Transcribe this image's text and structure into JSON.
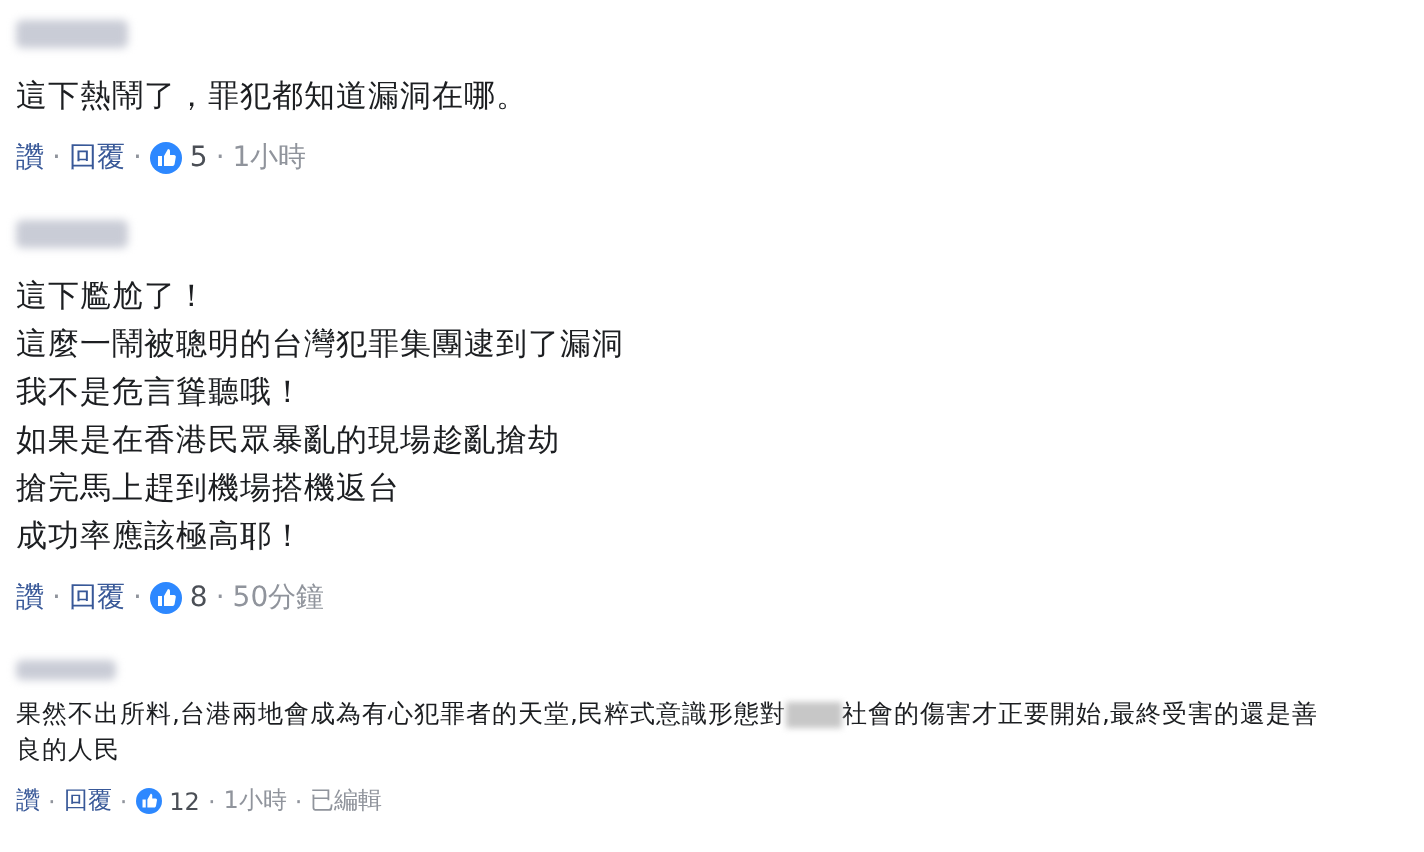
{
  "comments": [
    {
      "kind": "large",
      "lines": [
        [
          "這下熱鬧了，罪犯都知道漏洞在哪。"
        ]
      ],
      "actions": {
        "like": "讚",
        "sep": "·",
        "reply": "回覆",
        "likes": "5",
        "time": "1小時"
      }
    },
    {
      "kind": "large",
      "lines": [
        [
          "這下尷尬了！"
        ],
        [
          "這麼一鬧被聰明的台灣犯罪集團逮到了漏洞"
        ],
        [
          "我不是危言聳聽哦！"
        ],
        [
          "如果是在香港民眾暴亂的現場趁亂搶劫"
        ],
        [
          "搶完馬上趕到機場搭機返台"
        ],
        [
          "成功率應該極高耶！"
        ]
      ],
      "actions": {
        "like": "讚",
        "sep": "·",
        "reply": "回覆",
        "likes": "8",
        "time": "50分鐘"
      }
    },
    {
      "kind": "small",
      "lines": [
        [
          "果然不出所料,台港兩地會成為有心犯罪者的天堂,民粹式意識形態對",
          "社會的傷害才正要開始,最終受害的還是善"
        ],
        [
          "良的人民"
        ]
      ],
      "actions": {
        "like": "讚",
        "sep": "·",
        "reply": "回覆",
        "likes": "12",
        "time": "1小時",
        "edited": "已編輯"
      }
    }
  ]
}
